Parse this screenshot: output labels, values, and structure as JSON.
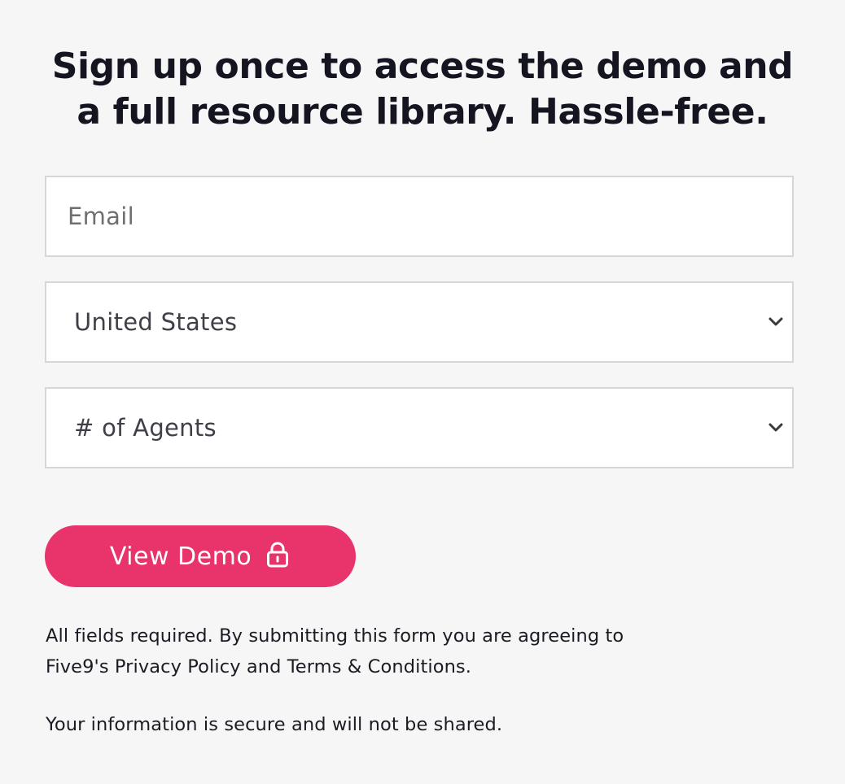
{
  "heading": {
    "line1": "Sign up once to access the demo and",
    "line2": "a full resource library. Hassle-free."
  },
  "form": {
    "email": {
      "placeholder": "Email",
      "value": ""
    },
    "country": {
      "selected": "United States",
      "icon": "chevron-down-icon"
    },
    "agents": {
      "selected": "# of Agents",
      "icon": "chevron-down-icon"
    },
    "submit": {
      "label": "View Demo",
      "icon": "lock-icon",
      "color": "#e8336b",
      "text_color": "#ffffff"
    }
  },
  "disclaimer": {
    "line1": "All fields required. By submitting this form you are agreeing to",
    "line2": "Five9's Privacy Policy and Terms & Conditions."
  },
  "secure_note": "Your information is secure and will not be shared.",
  "colors": {
    "background": "#f6f6f6",
    "field_border": "#d6d6d6",
    "heading_text": "#151522"
  }
}
